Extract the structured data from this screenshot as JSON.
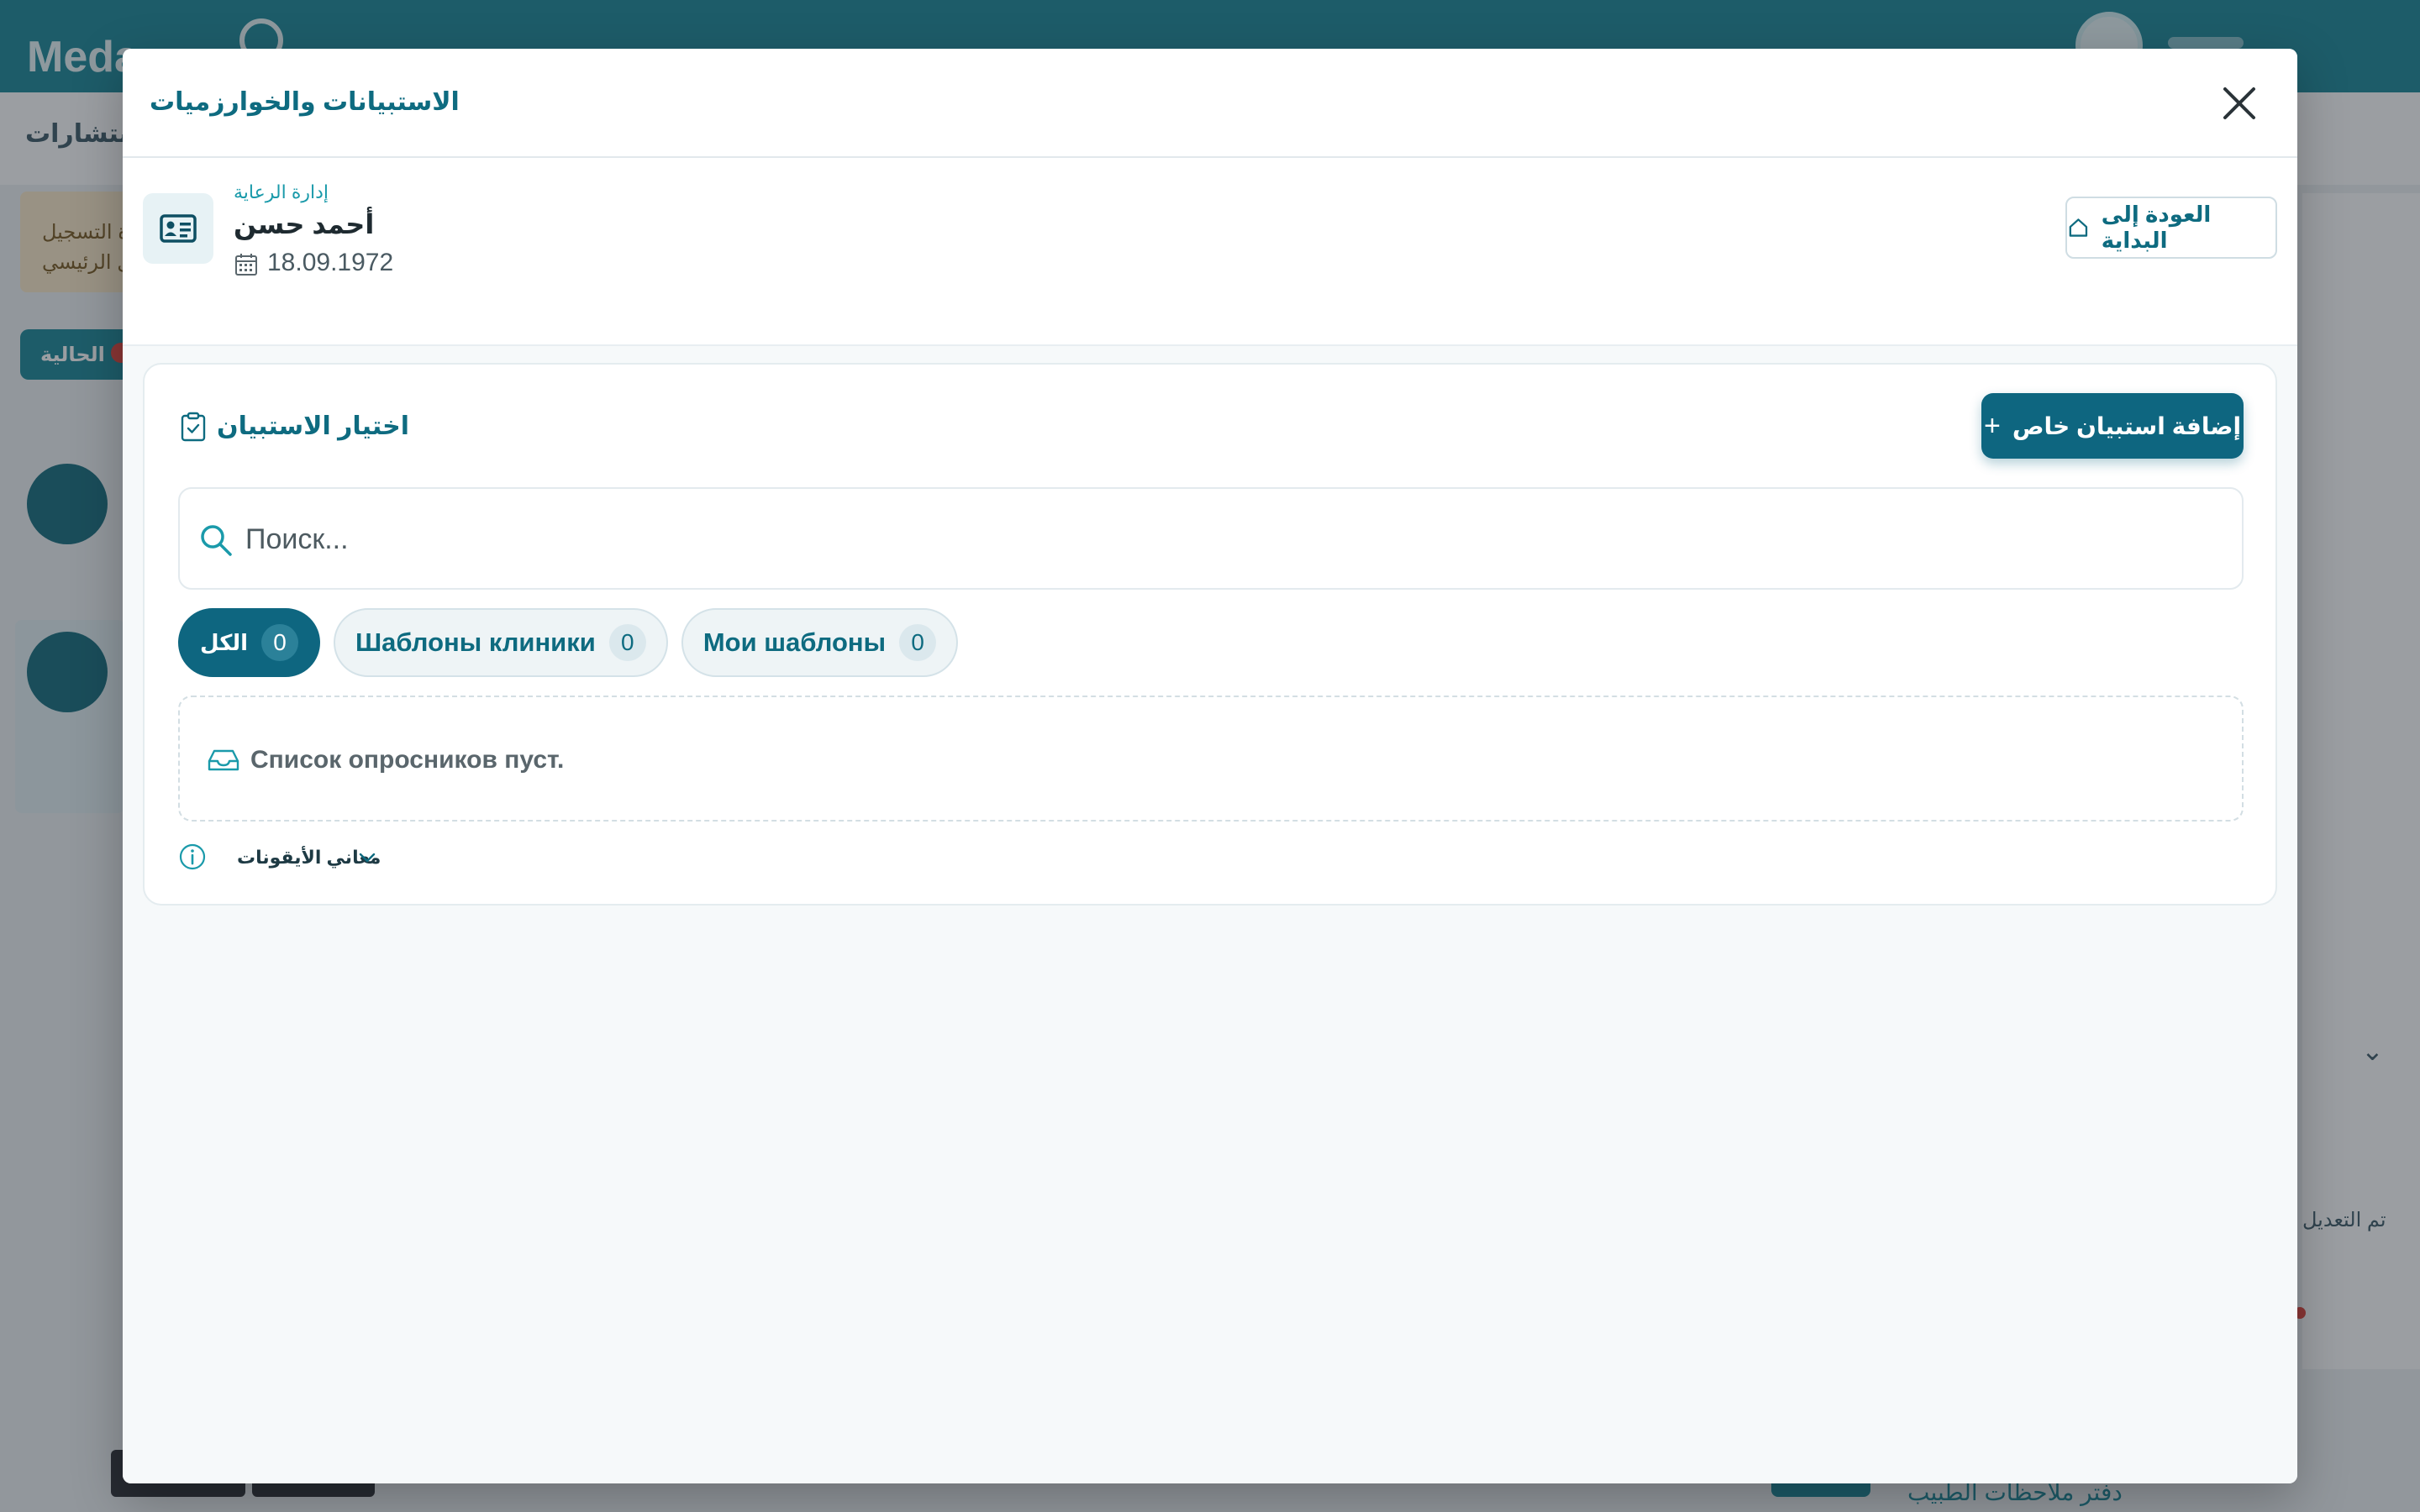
{
  "background": {
    "logo": "Meda",
    "subnav_text": "الاستشارات",
    "alert_line1": "إدارة التسجيل",
    "alert_line2": "السجل الرئيسي",
    "button_label": "الحالية",
    "right_text": "تم التعديل",
    "bottom_right_text": "دفتر ملاحظات الطبيب"
  },
  "modal": {
    "title": "الاستبيانات والخوارزميات",
    "close_icon": "close-icon"
  },
  "patient": {
    "department": "إدارة الرعاية",
    "name": "أحمد حسن",
    "dob": "18.09.1972",
    "home_button": "العودة إلى البداية"
  },
  "questionnaire": {
    "title": "اختيار الاستبيان",
    "add_button": "إضافة استبيان خاص",
    "search_placeholder": "Поиск...",
    "filters": [
      {
        "label": "الكل",
        "count": "0",
        "active": true
      },
      {
        "label": "Шаблоны клиники",
        "count": "0",
        "active": false
      },
      {
        "label": "Мои шаблоны",
        "count": "0",
        "active": false
      }
    ],
    "empty_text": "Список опросников пуст.",
    "legend_label": "معاني الأيقونات"
  },
  "colors": {
    "primary": "#0e6680",
    "accent_text": "#0e6b80",
    "topbar": "#1a8798"
  }
}
